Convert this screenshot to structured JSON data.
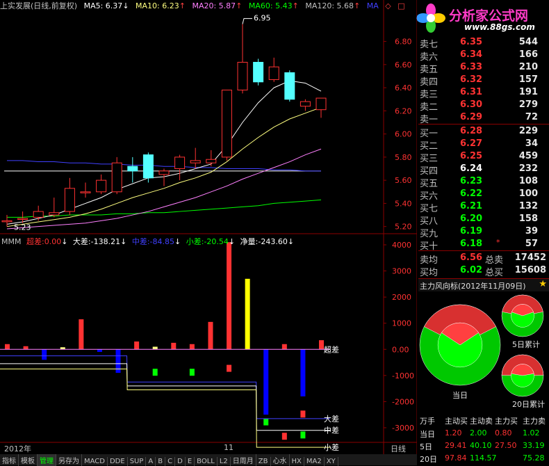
{
  "header": {
    "title": "上实发展(日线,前复权)",
    "ma5": "MA5: 6.37",
    "ma10": "MA10: 6.23",
    "ma20": "MA20: 5.87",
    "ma60": "MA60: 5.43",
    "ma120": "MA120: 5.68",
    "ma": "MA"
  },
  "colors": {
    "up": "#ff3232",
    "down": "#54ffff",
    "bg": "#000000",
    "grid": "#8b0000",
    "ma5": "#ffffff",
    "ma10": "#ffff80",
    "ma20": "#ff80ff",
    "ma60": "#00ff00",
    "ma120": "#4040ff"
  },
  "price_labels": {
    "high": "6.95",
    "low": "5.23"
  },
  "mmm": {
    "name": "MMM",
    "chao_label": "超差:",
    "chao_val": "0.00",
    "da_label": "大差:",
    "da_val": "-138.21",
    "zhong_label": "中差:",
    "zhong_val": "-84.85",
    "xiao_label": "小差:",
    "xiao_val": "-20.54",
    "jing_label": "净量:",
    "jing_val": "-243.60",
    "line_labels": [
      "超差",
      "大差",
      "中差",
      "小差"
    ]
  },
  "date_labels": {
    "year": "2012年",
    "month": "11"
  },
  "period": "日线",
  "logo": {
    "title": "分析家公式网",
    "url": "www.88gs.com"
  },
  "orderbook": {
    "sells": [
      {
        "label": "卖七",
        "price": "6.35",
        "vol": "544"
      },
      {
        "label": "卖六",
        "price": "6.34",
        "vol": "166"
      },
      {
        "label": "卖五",
        "price": "6.33",
        "vol": "210"
      },
      {
        "label": "卖四",
        "price": "6.32",
        "vol": "157"
      },
      {
        "label": "卖三",
        "price": "6.31",
        "vol": "191"
      },
      {
        "label": "卖二",
        "price": "6.30",
        "vol": "279"
      },
      {
        "label": "卖一",
        "price": "6.29",
        "vol": "72"
      }
    ],
    "buys": [
      {
        "label": "买一",
        "price": "6.28",
        "vol": "229"
      },
      {
        "label": "买二",
        "price": "6.27",
        "vol": "34"
      },
      {
        "label": "买三",
        "price": "6.25",
        "vol": "459"
      },
      {
        "label": "买四",
        "price": "6.24",
        "vol": "232"
      },
      {
        "label": "买五",
        "price": "6.23",
        "vol": "108"
      },
      {
        "label": "买六",
        "price": "6.22",
        "vol": "100"
      },
      {
        "label": "买七",
        "price": "6.21",
        "vol": "132"
      },
      {
        "label": "买八",
        "price": "6.20",
        "vol": "158"
      },
      {
        "label": "买九",
        "price": "6.19",
        "vol": "39"
      },
      {
        "label": "买十",
        "price": "6.18",
        "vol": "57"
      }
    ],
    "summary": [
      {
        "label": "卖均",
        "price": "6.56",
        "label2": "总卖",
        "vol": "17452"
      },
      {
        "label": "买均",
        "price": "6.02",
        "label2": "总买",
        "vol": "15608"
      }
    ]
  },
  "fund_panel": {
    "title": "主力风向标(2012年11月09日)",
    "today": "当日",
    "five_day": "5日累计",
    "twenty_day": "20日累计"
  },
  "flow_table": {
    "headers": [
      "万手",
      "主动买",
      "主动卖",
      "主力买",
      "主力卖"
    ],
    "rows": [
      {
        "label": "当日",
        "values": [
          "1.20",
          "2.00",
          "0.80",
          "1.02"
        ]
      },
      {
        "label": "5日",
        "values": [
          "29.41",
          "40.10",
          "27.50",
          "33.19"
        ]
      },
      {
        "label": "20日",
        "values": [
          "97.84",
          "114.57",
          "",
          "75.28"
        ]
      }
    ]
  },
  "toolbar": {
    "items": [
      "指标",
      "模板",
      "管理",
      "另存为",
      "MACD",
      "DDE",
      "SUP",
      "A",
      "B",
      "C",
      "D",
      "E",
      "BOLL",
      "L2",
      "日周月",
      "ZB",
      "心水",
      "HX",
      "MA2",
      "XY"
    ]
  },
  "chart_data": [
    {
      "type": "candlestick",
      "title": "上实发展(日线,前复权)",
      "ylim": [
        5.15,
        7.05
      ],
      "y_ticks": [
        5.2,
        5.4,
        5.6,
        5.8,
        6.0,
        6.2,
        6.4,
        6.6,
        6.8,
        6.0
      ],
      "y_tick_labels": [
        "5.20",
        "5.40",
        "5.60",
        "5.80",
        "6.00",
        "6.20",
        "6.40",
        "6.60",
        "6.80",
        "6.00"
      ],
      "candles": [
        {
          "o": 5.25,
          "h": 5.3,
          "l": 5.2,
          "c": 5.25
        },
        {
          "o": 5.27,
          "h": 5.33,
          "l": 5.23,
          "c": 5.27
        },
        {
          "o": 5.28,
          "h": 5.38,
          "l": 5.25,
          "c": 5.33
        },
        {
          "o": 5.3,
          "h": 5.45,
          "l": 5.28,
          "c": 5.32
        },
        {
          "o": 5.33,
          "h": 5.62,
          "l": 5.3,
          "c": 5.53
        },
        {
          "o": 5.5,
          "h": 5.58,
          "l": 5.45,
          "c": 5.5
        },
        {
          "o": 5.5,
          "h": 5.65,
          "l": 5.48,
          "c": 5.6
        },
        {
          "o": 5.5,
          "h": 5.8,
          "l": 5.48,
          "c": 5.75
        },
        {
          "o": 5.72,
          "h": 5.8,
          "l": 5.58,
          "c": 5.68
        },
        {
          "o": 5.82,
          "h": 5.84,
          "l": 5.58,
          "c": 5.62
        },
        {
          "o": 5.65,
          "h": 5.7,
          "l": 5.55,
          "c": 5.68
        },
        {
          "o": 5.7,
          "h": 5.82,
          "l": 5.6,
          "c": 5.8
        },
        {
          "o": 5.75,
          "h": 5.88,
          "l": 5.7,
          "c": 5.77
        },
        {
          "o": 5.75,
          "h": 5.86,
          "l": 5.72,
          "c": 5.78
        },
        {
          "o": 5.8,
          "h": 6.2,
          "l": 5.77,
          "c": 6.38
        },
        {
          "o": 6.38,
          "h": 6.95,
          "l": 6.35,
          "c": 6.62
        },
        {
          "o": 6.62,
          "h": 6.65,
          "l": 6.42,
          "c": 6.45
        },
        {
          "o": 6.47,
          "h": 6.66,
          "l": 6.45,
          "c": 6.58
        },
        {
          "o": 6.53,
          "h": 6.55,
          "l": 6.28,
          "c": 6.3
        },
        {
          "o": 6.24,
          "h": 6.3,
          "l": 6.2,
          "c": 6.28
        },
        {
          "o": 6.21,
          "h": 6.31,
          "l": 6.14,
          "c": 6.31
        }
      ],
      "ma5": [
        5.22,
        5.24,
        5.27,
        5.3,
        5.35,
        5.4,
        5.45,
        5.52,
        5.57,
        5.62,
        5.63,
        5.66,
        5.7,
        5.74,
        5.9,
        6.1,
        6.27,
        6.4,
        6.46,
        6.44,
        6.37
      ],
      "ma10": [
        5.2,
        5.22,
        5.24,
        5.26,
        5.28,
        5.31,
        5.35,
        5.4,
        5.45,
        5.49,
        5.53,
        5.58,
        5.62,
        5.67,
        5.76,
        5.87,
        5.97,
        6.06,
        6.13,
        6.18,
        6.23
      ],
      "ma20": [
        5.18,
        5.19,
        5.2,
        5.21,
        5.22,
        5.23,
        5.25,
        5.27,
        5.3,
        5.33,
        5.37,
        5.41,
        5.45,
        5.5,
        5.55,
        5.61,
        5.66,
        5.71,
        5.76,
        5.82,
        5.87
      ],
      "ma60": [
        5.28,
        5.28,
        5.29,
        5.29,
        5.3,
        5.3,
        5.3,
        5.31,
        5.31,
        5.32,
        5.32,
        5.33,
        5.34,
        5.35,
        5.36,
        5.37,
        5.38,
        5.4,
        5.41,
        5.42,
        5.43
      ],
      "ma120": [
        5.77,
        5.77,
        5.76,
        5.76,
        5.75,
        5.75,
        5.74,
        5.74,
        5.73,
        5.73,
        5.72,
        5.72,
        5.71,
        5.71,
        5.7,
        5.7,
        5.7,
        5.69,
        5.69,
        5.68,
        5.68
      ],
      "hline": 5.68
    },
    {
      "type": "bar",
      "name": "MMM",
      "ylim": [
        -3400,
        4000
      ],
      "y_tick_labels": [
        "4000",
        "3000",
        "2000",
        "1000",
        "0.00",
        "-1000",
        "-2000",
        "-3000"
      ],
      "y_ticks": [
        4000,
        3000,
        2000,
        1000,
        0,
        -1000,
        -2000,
        -3000
      ],
      "bars": [
        {
          "x": 1,
          "v": 200,
          "c": "#ff3232"
        },
        {
          "x": 2,
          "v": 120,
          "c": "#ff3232"
        },
        {
          "x": 3,
          "v": -400,
          "c": "#0000ff"
        },
        {
          "x": 4,
          "v": 80,
          "c": "#ffff80"
        },
        {
          "x": 5,
          "v": 1150,
          "c": "#ff3232"
        },
        {
          "x": 6,
          "v": -100,
          "c": "#0000ff"
        },
        {
          "x": 7,
          "v": -900,
          "c": "#0000ff"
        },
        {
          "x": 8,
          "v": 300,
          "c": "#ff3232"
        },
        {
          "x": 9,
          "v": 100,
          "c": "#ffff80"
        },
        {
          "x": 10,
          "v": 250,
          "c": "#ff3232"
        },
        {
          "x": 11,
          "v": 200,
          "c": "#ff3232"
        },
        {
          "x": 12,
          "v": 1050,
          "c": "#ff3232"
        },
        {
          "x": 13,
          "v": 4100,
          "c": "#ff3232"
        },
        {
          "x": 14,
          "v": 2700,
          "c": "#ffff00"
        },
        {
          "x": 15,
          "v": -2500,
          "c": "#0000ff"
        },
        {
          "x": 16,
          "v": 200,
          "c": "#ff3232"
        },
        {
          "x": 17,
          "v": -1800,
          "c": "#0000ff"
        },
        {
          "x": 18,
          "v": 350,
          "c": "#ff3232"
        }
      ],
      "lines": {
        "chao": [
          0,
          0,
          0,
          0,
          0,
          0,
          0,
          0,
          0,
          0,
          0,
          0,
          0,
          0,
          0,
          0,
          0,
          0
        ],
        "da": [
          -250,
          -250,
          -250,
          -250,
          -250,
          -250,
          -250,
          -1250,
          -1250,
          -1250,
          -1250,
          -1250,
          -1250,
          -1250,
          -2650,
          -2650,
          -2650,
          -2650
        ],
        "zhong": [
          -550,
          -550,
          -550,
          -550,
          -550,
          -550,
          -550,
          -1400,
          -1400,
          -1400,
          -1400,
          -1400,
          -1400,
          -1400,
          -3100,
          -3100,
          -3100,
          -3100
        ],
        "xiao": [
          -750,
          -750,
          -750,
          -750,
          -750,
          -750,
          -750,
          -1550,
          -1550,
          -1550,
          -1550,
          -1550,
          -1550,
          -1550,
          -3750,
          -3750,
          -3750,
          -3750
        ]
      }
    },
    {
      "type": "pie",
      "title": "主力风向标",
      "series": [
        {
          "name": "当日",
          "values": [
            35,
            65
          ]
        },
        {
          "name": "5日累计",
          "values": [
            40,
            60
          ]
        },
        {
          "name": "20日累计",
          "values": [
            45,
            55
          ]
        }
      ]
    }
  ]
}
